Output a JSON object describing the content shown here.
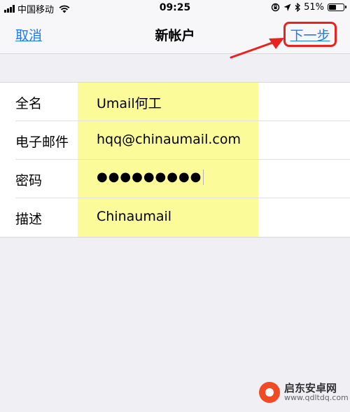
{
  "status_bar": {
    "carrier": "中国移动",
    "time": "09:25",
    "battery_text": "51%",
    "battery_level": 0.51,
    "icons": [
      "signal-icon",
      "wifi-icon",
      "orientation-lock-icon",
      "location-icon",
      "bluetooth-icon",
      "battery-icon"
    ]
  },
  "nav": {
    "cancel_label": "取消",
    "title": "新帐户",
    "next_label": "下一步"
  },
  "form": {
    "rows": [
      {
        "label": "全名",
        "value": "Umail何工"
      },
      {
        "label": "电子邮件",
        "value": "hqq@chinaumail.com"
      },
      {
        "label": "密码",
        "value": "●●●●●●●●●"
      },
      {
        "label": "描述",
        "value": "Chinaumail"
      }
    ]
  },
  "annotation": {
    "highlight_color": "#fbfb9a",
    "box_color": "#e8231e"
  },
  "watermark": {
    "name": "启东安卓网",
    "url": "www.qdltdq.com"
  },
  "colors": {
    "accent": "#1a7cf5",
    "background": "#efeff4"
  }
}
